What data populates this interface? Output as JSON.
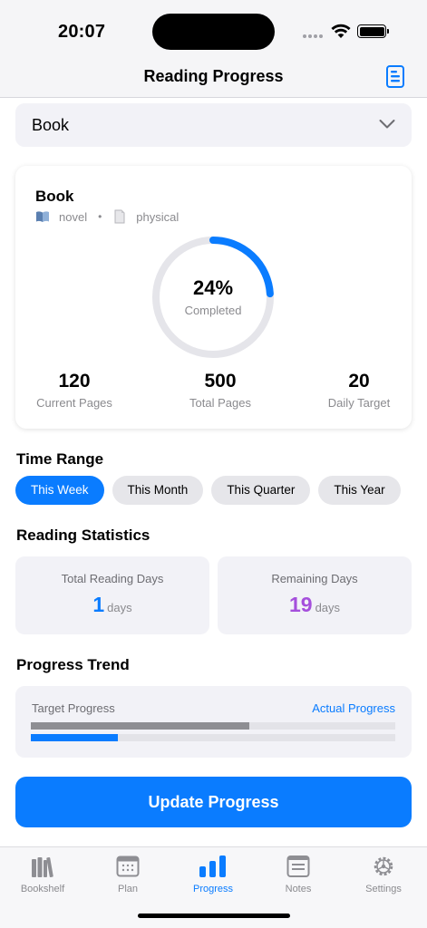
{
  "status_bar": {
    "time": "20:07"
  },
  "nav": {
    "title": "Reading Progress"
  },
  "book_selector": {
    "value": "Book"
  },
  "book": {
    "title": "Book",
    "genre": "novel",
    "format": "physical",
    "percent": 24,
    "percent_text": "24%",
    "completed_label": "Completed",
    "current_pages": "120",
    "current_pages_label": "Current Pages",
    "total_pages": "500",
    "total_pages_label": "Total Pages",
    "daily_target": "20",
    "daily_target_label": "Daily Target"
  },
  "time_range": {
    "title": "Time Range",
    "options": [
      "This Week",
      "This Month",
      "This Quarter",
      "This Year"
    ],
    "selected": "This Week"
  },
  "reading_statistics": {
    "title": "Reading Statistics",
    "total_days_label": "Total Reading Days",
    "total_days": "1",
    "total_days_unit": "days",
    "remaining_days_label": "Remaining Days",
    "remaining_days": "19",
    "remaining_days_unit": "days"
  },
  "progress_trend": {
    "title": "Progress Trend",
    "target_label": "Target Progress",
    "actual_label": "Actual Progress",
    "target_progress": 0.6,
    "actual_progress": 0.24
  },
  "update_button": {
    "label": "Update Progress"
  },
  "tabs": [
    {
      "label": "Bookshelf",
      "icon": "books-icon"
    },
    {
      "label": "Plan",
      "icon": "calendar-icon"
    },
    {
      "label": "Progress",
      "icon": "bar-chart-icon"
    },
    {
      "label": "Notes",
      "icon": "notes-icon"
    },
    {
      "label": "Settings",
      "icon": "gear-icon"
    }
  ],
  "active_tab": "Progress",
  "colors": {
    "accent": "#0a7cff",
    "remaining_days": "#a54fdc",
    "target_bar": "#8e8e93",
    "ring_track": "#e5e5ea",
    "inactive_tab": "#8e8e93"
  }
}
